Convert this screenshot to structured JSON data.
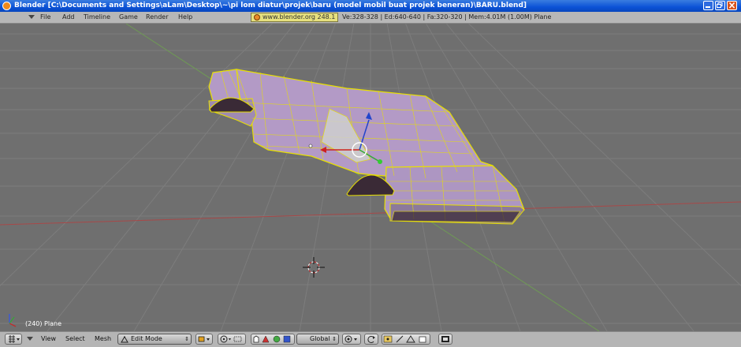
{
  "window": {
    "title": "Blender [C:\\Documents and Settings\\aLam\\Desktop\\~\\pi lom diatur\\projek\\baru (model mobil buat projek beneran)\\BARU.blend]"
  },
  "menubar": {
    "items": [
      "File",
      "Add",
      "Timeline",
      "Game",
      "Render",
      "Help"
    ],
    "url": "www.blender.org 248.1",
    "stats": "Ve:328-328 | Ed:640-640 | Fa:320-320 | Mem:4.01M (1.00M) Plane"
  },
  "viewport": {
    "selection_label": "(240) Plane",
    "colors": {
      "background": "#6f6f6f",
      "grid": "#7a7a7a",
      "mesh_face": "#b39ac6",
      "mesh_edge": "#e8e000",
      "x_axis": "#b04040",
      "y_axis": "#6e9a52"
    }
  },
  "toolbar": {
    "view": "View",
    "select": "Select",
    "mesh": "Mesh",
    "mode": "Edit Mode",
    "orientation": "Global"
  }
}
